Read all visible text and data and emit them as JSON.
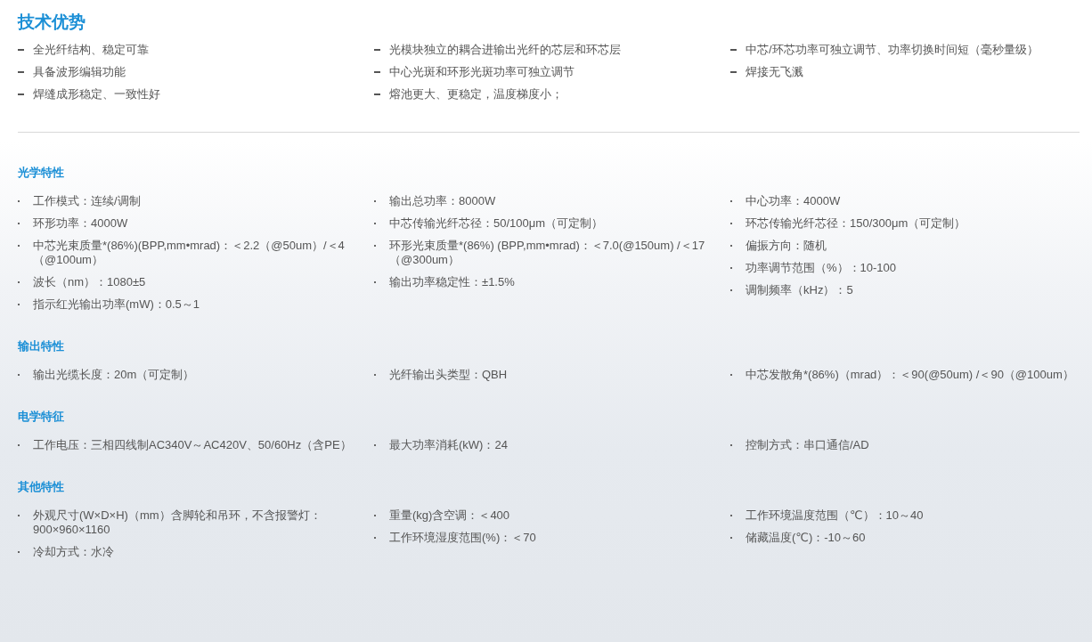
{
  "title": "技术优势",
  "advantages": [
    [
      "全光纤结构、稳定可靠",
      "具备波形编辑功能",
      "焊缝成形稳定、一致性好"
    ],
    [
      "光模块独立的耦合进输出光纤的芯层和环芯层",
      "中心光斑和环形光斑功率可独立调节",
      "熔池更大、更稳定，温度梯度小；"
    ],
    [
      "中芯/环芯功率可独立调节、功率切换时间短（毫秒量级）",
      "焊接无飞溅"
    ]
  ],
  "sections": [
    {
      "heading": "光学特性",
      "columns": [
        [
          "工作模式：连续/调制",
          "环形功率：4000W",
          "中芯光束质量*(86%)(BPP,mm•mrad)：＜2.2（@50um）/＜4（@100um）",
          "波长（nm）：1080±5",
          "指示红光输出功率(mW)：0.5～1"
        ],
        [
          "输出总功率：8000W",
          "中芯传输光纤芯径：50/100μm（可定制）",
          "环形光束质量*(86%) (BPP,mm•mrad)：＜7.0(@150um) /＜17（@300um）",
          "输出功率稳定性：±1.5%"
        ],
        [
          "中心功率：4000W",
          "环芯传输光纤芯径：150/300μm（可定制）",
          "偏振方向：随机",
          "功率调节范围（%）：10-100",
          "调制频率（kHz）：5"
        ]
      ]
    },
    {
      "heading": "输出特性",
      "columns": [
        [
          "输出光缆长度：20m（可定制）"
        ],
        [
          "光纤输出头类型：QBH"
        ],
        [
          "中芯发散角*(86%)（mrad）：＜90(@50um) /＜90（@100um）"
        ]
      ]
    },
    {
      "heading": "电学特征",
      "columns": [
        [
          "工作电压：三相四线制AC340V～AC420V、50/60Hz（含PE）"
        ],
        [
          "最大功率消耗(kW)：24"
        ],
        [
          "控制方式：串口通信/AD"
        ]
      ]
    },
    {
      "heading": "其他特性",
      "columns": [
        [
          "外观尺寸(W×D×H)（mm）含脚轮和吊环，不含报警灯：900×960×1160",
          "冷却方式：水冷"
        ],
        [
          "重量(kg)含空调：＜400",
          "工作环境湿度范围(%)：＜70"
        ],
        [
          "工作环境温度范围（℃）：10～40",
          "储藏温度(℃)：-10～60"
        ]
      ]
    }
  ]
}
